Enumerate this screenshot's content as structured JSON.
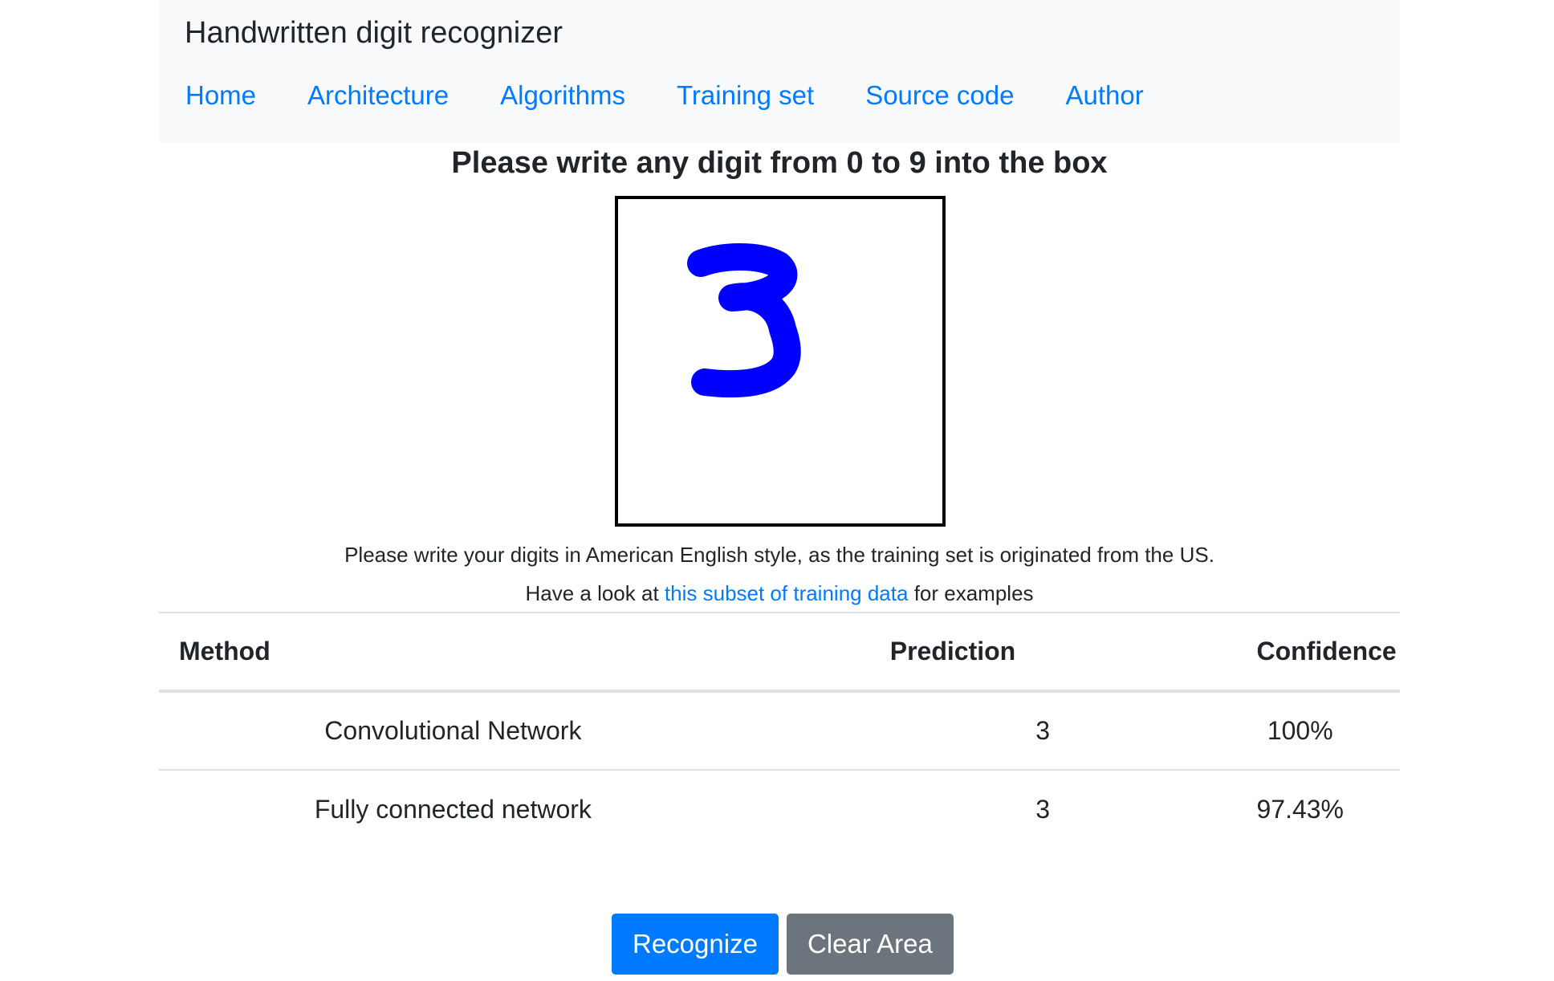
{
  "navbar": {
    "brand": "Handwritten digit recognizer",
    "links": [
      "Home",
      "Architecture",
      "Algorithms",
      "Training set",
      "Source code",
      "Author"
    ]
  },
  "main": {
    "heading": "Please write any digit from 0 to 9 into the box",
    "drawn_digit": "3",
    "stroke_color": "#0000ff",
    "note": "Please write your digits in American English style, as the training set is originated from the US.",
    "look_prefix": "Have a look at",
    "look_link": "this subset of training data",
    "look_suffix": "for examples"
  },
  "results": {
    "headers": [
      "Method",
      "Prediction",
      "Confidence"
    ],
    "rows": [
      {
        "method": "Convolutional Network",
        "prediction": "3",
        "confidence": "100%"
      },
      {
        "method": "Fully connected network",
        "prediction": "3",
        "confidence": "97.43%"
      }
    ]
  },
  "buttons": {
    "recognize": "Recognize",
    "clear": "Clear Area"
  },
  "colors": {
    "link": "#007bff",
    "primary": "#007bff",
    "secondary": "#6c757d",
    "navbar_bg": "#f8f9fa"
  }
}
